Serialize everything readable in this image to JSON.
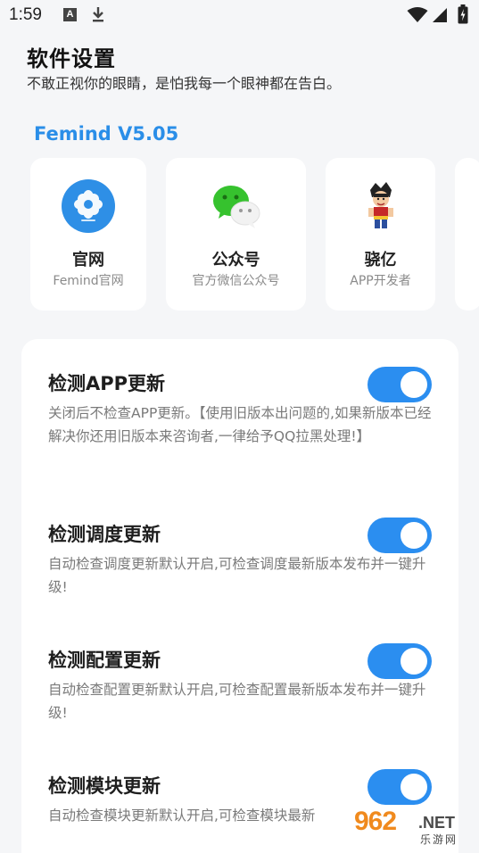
{
  "status_bar": {
    "time": "1:59",
    "notification_letter": "A",
    "icons": [
      "download-icon",
      "wifi-icon",
      "cellular-icon",
      "battery-charging-icon"
    ]
  },
  "header": {
    "title": "软件设置",
    "subtitle": "不敢正视你的眼睛，是怕我每一个眼神都在告白。"
  },
  "version": "Femind V5.05",
  "links": [
    {
      "name": "官网",
      "desc": "Femind官网",
      "icon": "website-flower-icon"
    },
    {
      "name": "公众号",
      "desc": "官方微信公众号",
      "icon": "wechat-icon"
    },
    {
      "name": "骁亿",
      "desc": "APP开发者",
      "icon": "developer-avatar"
    }
  ],
  "settings": [
    {
      "title": "检测APP更新",
      "desc": "关闭后不检查APP更新。【使用旧版本出问题的,如果新版本已经解决你还用旧版本来咨询者,一律给予QQ拉黑处理!】",
      "enabled": true
    },
    {
      "title": "检测调度更新",
      "desc": "自动检查调度更新默认开启,可检查调度最新版本发布并一键升级!",
      "enabled": true
    },
    {
      "title": "检测配置更新",
      "desc": "自动检查配置更新默认开启,可检查配置最新版本发布并一键升级!",
      "enabled": true
    },
    {
      "title": "检测模块更新",
      "desc": "自动检查模块更新默认开启,可检查模块最新",
      "enabled": true
    }
  ],
  "watermark": {
    "big": "962",
    "net": ".NET",
    "cn": "乐游网"
  },
  "colors": {
    "accent": "#2b8ef0",
    "version_text": "#2a8ee8",
    "background": "#f5f6f8"
  }
}
